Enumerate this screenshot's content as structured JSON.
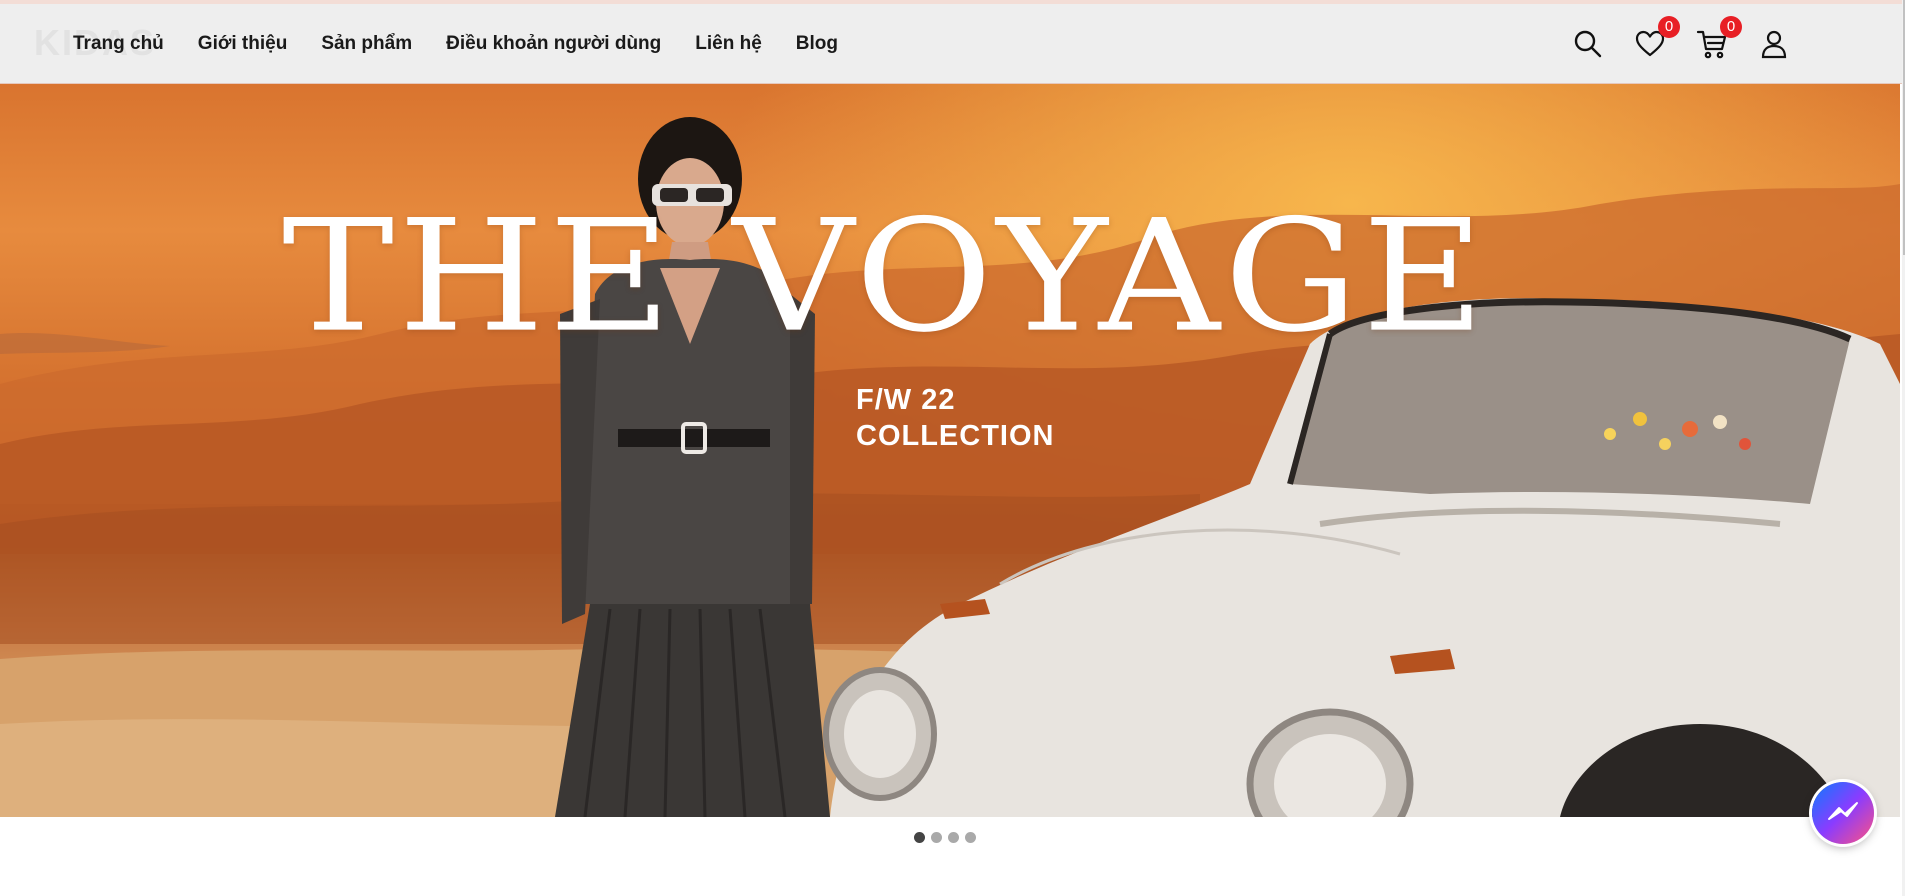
{
  "nav": {
    "logo_text": "KIDAS",
    "links": [
      "Trang chủ",
      "Giới thiệu",
      "Sản phẩm",
      "Điều khoản người dùng",
      "Liên hệ",
      "Blog"
    ],
    "icons": [
      "search-icon",
      "heart-icon",
      "cart-icon",
      "user-icon"
    ],
    "wishlist_count": "0",
    "cart_count": "0"
  },
  "hero": {
    "title": "THE VOYAGE",
    "subtitle_line1": "F/W 22",
    "subtitle_line2": "COLLECTION"
  },
  "carousel": {
    "slides": 4,
    "active_index": 0
  },
  "chat": {
    "icon": "messenger-icon"
  },
  "colors": {
    "badge": "#e81f25",
    "navbar_bg": "#eeeeee",
    "hero_orange": "#e78b3e"
  }
}
